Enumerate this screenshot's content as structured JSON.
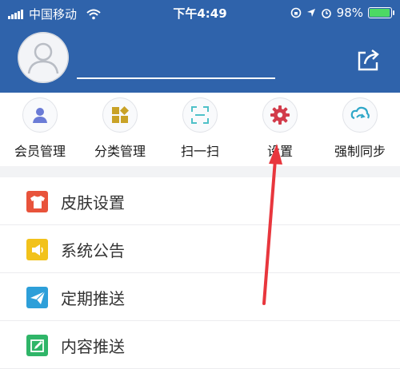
{
  "status": {
    "carrier": "中国移动",
    "time": "下午4:49",
    "battery": "98%",
    "battery_level": 0.98
  },
  "quick_actions": [
    {
      "label": "会员管理",
      "icon": "member-icon",
      "color": "#6a7bd6"
    },
    {
      "label": "分类管理",
      "icon": "category-icon",
      "color": "#c9a227"
    },
    {
      "label": "扫一扫",
      "icon": "scan-icon",
      "color": "#4fc1c8"
    },
    {
      "label": "设置",
      "icon": "gear-icon",
      "color": "#d23b4b"
    },
    {
      "label": "强制同步",
      "icon": "sync-icon",
      "color": "#2fa7c8"
    }
  ],
  "menu": [
    {
      "label": "皮肤设置",
      "icon": "shirt-icon",
      "color": "#e8533b"
    },
    {
      "label": "系统公告",
      "icon": "speaker-icon",
      "color": "#f2c21b"
    },
    {
      "label": "定期推送",
      "icon": "paper-plane-icon",
      "color": "#2d9fd9"
    },
    {
      "label": "内容推送",
      "icon": "edit-icon",
      "color": "#2fb568"
    }
  ],
  "colors": {
    "header": "#2f63ab",
    "annotation_arrow": "#e8363d"
  }
}
